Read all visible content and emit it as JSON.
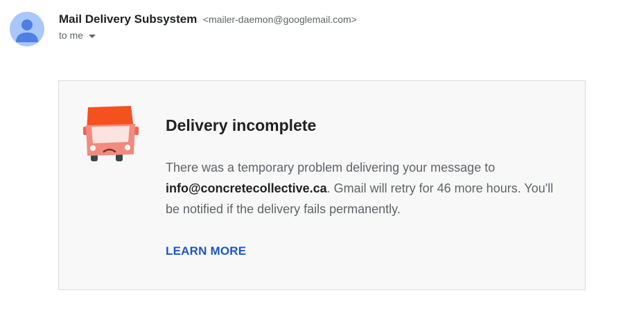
{
  "header": {
    "sender_name": "Mail Delivery Subsystem",
    "sender_email": "<mailer-daemon@googlemail.com>",
    "recipient_label": "to me",
    "avatar_icon": "person-icon",
    "caret_icon": "caret-down-icon"
  },
  "card": {
    "icon": "sad-truck-icon",
    "title": "Delivery incomplete",
    "message_part1": "There was a temporary problem delivering your message to ",
    "recipient_address": "info@concretecollective.ca",
    "message_part2": ". Gmail will retry for 46 more hours. You'll be notified if the delivery fails permanently.",
    "link_label": "LEARN MORE"
  },
  "colors": {
    "link": "#1a56c9",
    "avatar_bg": "#a8c7fa",
    "avatar_figure": "#4f7fe3",
    "truck_body": "#f0645a",
    "truck_roof": "#f4511e",
    "card_bg": "#f8f8f8"
  }
}
